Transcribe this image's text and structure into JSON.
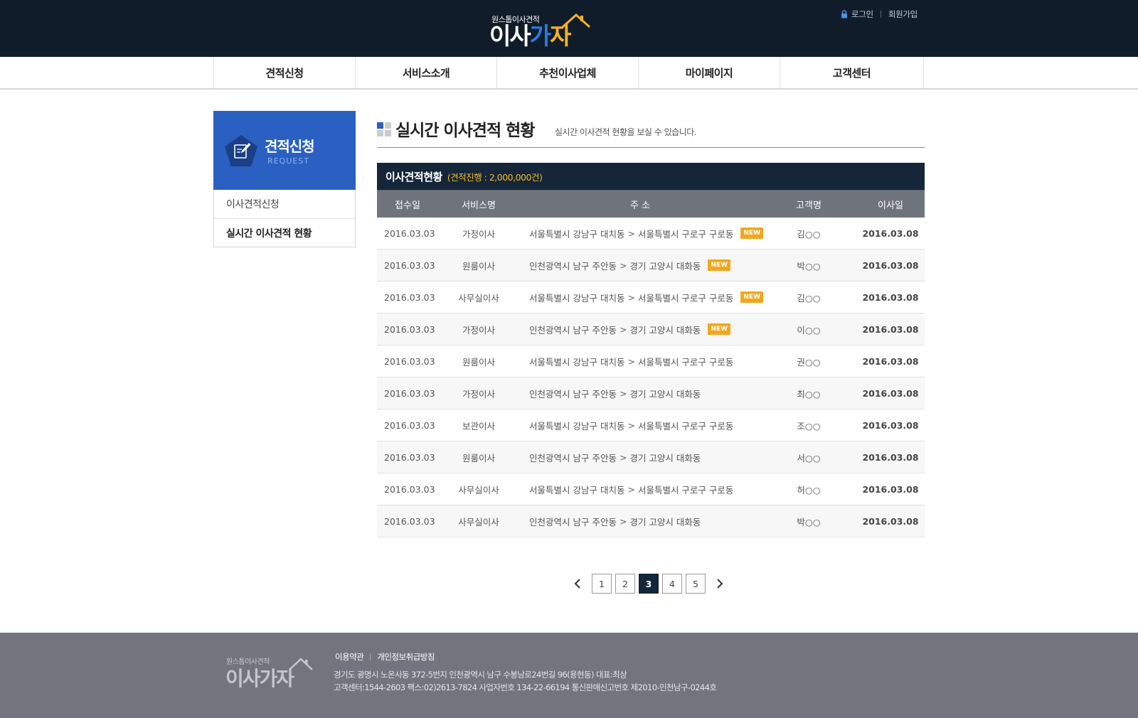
{
  "header": {
    "logo_sub": "원스톱이사견적",
    "logo_main_1": "이사",
    "logo_main_2": "가",
    "logo_main_3": "자",
    "login": "로그인",
    "join": "회원가입"
  },
  "gnb": {
    "items": [
      "견적신청",
      "서비스소개",
      "추천이사업체",
      "마이페이지",
      "고객센터"
    ]
  },
  "lnb": {
    "title": "견적신청",
    "title_en": "REQUEST",
    "items": [
      "이사견적신청",
      "실시간 이사견적 현황"
    ]
  },
  "content": {
    "title": "실시간 이사견적 현황",
    "desc": "실시간 이사견적 현황을 보실 수 있습니다.",
    "table_caption": "이사견적현황",
    "table_count": "(견적진행 : 2,000,000건)",
    "columns": [
      "접수일",
      "서비스명",
      "주 소",
      "고객명",
      "이사일"
    ],
    "new_label": "NEW",
    "rows": [
      {
        "date": "2016.03.03",
        "service": "가정이사",
        "addr_from": "서울특별시 강남구 대치동",
        "addr_to": "서울특별시 구로구 구로동",
        "name": "김○○",
        "move_date": "2016.03.08",
        "is_new": true
      },
      {
        "date": "2016.03.03",
        "service": "원룸이사",
        "addr_from": "인천광역시 남구 주안동",
        "addr_to": "경기 고양시 대화동",
        "name": "박○○",
        "move_date": "2016.03.08",
        "is_new": true
      },
      {
        "date": "2016.03.03",
        "service": "사무실이사",
        "addr_from": "서울특별시 강남구 대치동",
        "addr_to": "서울특별시 구로구 구로동",
        "name": "김○○",
        "move_date": "2016.03.08",
        "is_new": true
      },
      {
        "date": "2016.03.03",
        "service": "가정이사",
        "addr_from": "인천광역시 남구 주안동",
        "addr_to": "경기 고양시 대화동",
        "name": "이○○",
        "move_date": "2016.03.08",
        "is_new": true
      },
      {
        "date": "2016.03.03",
        "service": "원룸이사",
        "addr_from": "서울특별시 강남구 대치동",
        "addr_to": "서울특별시 구로구 구로동",
        "name": "권○○",
        "move_date": "2016.03.08",
        "is_new": false
      },
      {
        "date": "2016.03.03",
        "service": "가정이사",
        "addr_from": "인천광역시 남구 주안동",
        "addr_to": "경기 고양시 대화동",
        "name": "최○○",
        "move_date": "2016.03.08",
        "is_new": false
      },
      {
        "date": "2016.03.03",
        "service": "보관이사",
        "addr_from": "서울특별시 강남구 대치동",
        "addr_to": "서울특별시 구로구 구로동",
        "name": "조○○",
        "move_date": "2016.03.08",
        "is_new": false
      },
      {
        "date": "2016.03.03",
        "service": "원룸이사",
        "addr_from": "인천광역시 남구 주안동",
        "addr_to": "경기 고양시 대화동",
        "name": "서○○",
        "move_date": "2016.03.08",
        "is_new": false
      },
      {
        "date": "2016.03.03",
        "service": "사무실이사",
        "addr_from": "서울특별시 강남구 대치동",
        "addr_to": "서울특별시 구로구 구로동",
        "name": "허○○",
        "move_date": "2016.03.08",
        "is_new": false
      },
      {
        "date": "2016.03.03",
        "service": "사무실이사",
        "addr_from": "인천광역시 남구 주안동",
        "addr_to": "경기 고양시 대화동",
        "name": "박○○",
        "move_date": "2016.03.08",
        "is_new": false
      }
    ]
  },
  "pagination": {
    "pages": [
      "1",
      "2",
      "3",
      "4",
      "5"
    ],
    "current": "3"
  },
  "footer": {
    "logo_sub": "원스톱이사견적",
    "logo_main": "이사가자",
    "link_terms": "이용약관",
    "link_privacy": "개인정보취급방침",
    "info_line1": "경기도 광명시 노온사동 372-5번지 인천광역시 남구 수봉남로24번길 96(용현동)   대표:최상",
    "info_line2": "고객센터:1544-2603  팩스:02)2613-7824 사업자번호 134-22-66194   통신판매신고번호 제2010-인천남구-0244호"
  },
  "colors": {
    "header_bg": "#101c2a",
    "brand_blue": "#2960c2",
    "accent_yellow": "#f3b92b",
    "table_caption_bg": "#142638",
    "table_head_bg": "#6f737b",
    "footer_bg": "#72757d"
  },
  "icons": {
    "lock": "lock-icon",
    "lnb": "pencil-note-icon",
    "prev": "chevron-left-icon",
    "next": "chevron-right-icon"
  }
}
